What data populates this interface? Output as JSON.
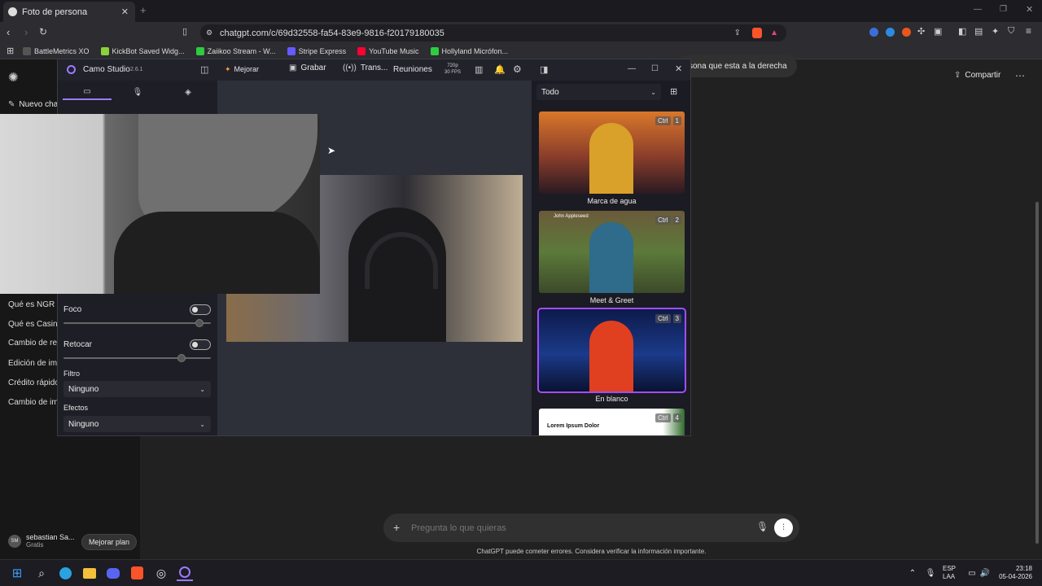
{
  "browser": {
    "tab_title": "Foto de persona",
    "url": "chatgpt.com/c/69d32558-fa54-83e9-9816-f20179180035",
    "bookmarks": [
      {
        "label": "BattleMetrics XO",
        "color": "#555"
      },
      {
        "label": "KickBot Saved Widg...",
        "color": "#8ad13a"
      },
      {
        "label": "Zaiikoo Stream - W...",
        "color": "#2ecc40"
      },
      {
        "label": "Stripe Express",
        "color": "#635bff"
      },
      {
        "label": "YouTube Music",
        "color": "#ff0033"
      },
      {
        "label": "Hollyland Micrófon...",
        "color": "#2ecc40"
      }
    ]
  },
  "gpt": {
    "new_chat": "Nuevo cha",
    "history": [
      "Qué es NGR e",
      "Qué es Casino",
      "Cambio de res",
      "Edición de imá",
      "Crédito rápido",
      "Cambio de ima"
    ],
    "user_name": "sebastian Sa...",
    "user_initials": "SM",
    "plan": "Gratis",
    "upgrade": "Mejorar plan",
    "share": "Compartir",
    "top_text": "sona que esta a la derecha",
    "placeholder": "Pregunta lo que quieras",
    "disclaimer": "ChatGPT puede cometer errores. Considera verificar la información importante."
  },
  "camo": {
    "title": "Camo Studio",
    "version": "2.6.1",
    "improve": "Mejorar",
    "record": "Grabar",
    "stream": "Trans...",
    "meetings": "Reuniones",
    "res_top": "720p",
    "res_bottom": "30 FPS",
    "focus": "Foco",
    "retouch": "Retocar",
    "filter_label": "Filtro",
    "filter_value": "Ninguno",
    "effects_label": "Efectos",
    "effects_value": "Ninguno",
    "filter_all": "Todo",
    "focus_level": 0.95,
    "retouch_level": 0.82,
    "scenes": [
      {
        "caption": "Marca de agua",
        "ctrl": "Ctrl",
        "num": "1"
      },
      {
        "caption": "Meet & Greet",
        "ctrl": "Ctrl",
        "num": "2",
        "overlay": "John Appleseed"
      },
      {
        "caption": "En blanco",
        "ctrl": "Ctrl",
        "num": "3"
      },
      {
        "caption": "",
        "ctrl": "Ctrl",
        "num": "4",
        "card": "Lorem Ipsum Dolor"
      }
    ]
  },
  "taskbar": {
    "lang1": "ESP",
    "lang2": "LAA",
    "time": "23:18",
    "date": "05-04-2026"
  }
}
